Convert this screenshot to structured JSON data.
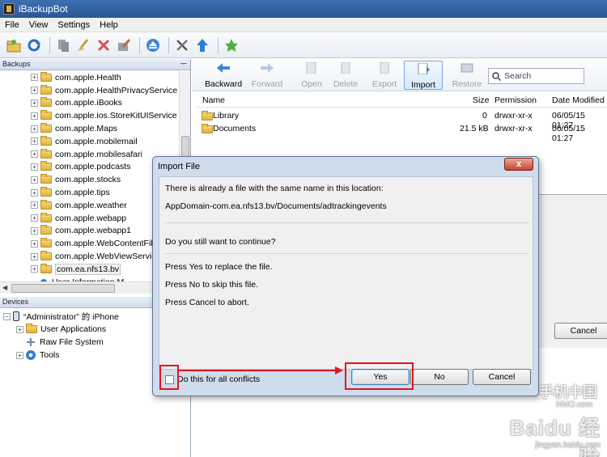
{
  "window": {
    "title": "iBackupBot"
  },
  "menu": [
    "File",
    "View",
    "Settings",
    "Help"
  ],
  "backups_panel": {
    "header": "Backups",
    "pin": "ᅮ",
    "items": [
      {
        "label": "com.apple.Health"
      },
      {
        "label": "com.apple.HealthPrivacyService"
      },
      {
        "label": "com.apple.iBooks"
      },
      {
        "label": "com.apple.ios.StoreKitUIService"
      },
      {
        "label": "com.apple.Maps"
      },
      {
        "label": "com.apple.mobilemail"
      },
      {
        "label": "com.apple.mobilesafari"
      },
      {
        "label": "com.apple.podcasts"
      },
      {
        "label": "com.apple.stocks"
      },
      {
        "label": "com.apple.tips"
      },
      {
        "label": "com.apple.weather"
      },
      {
        "label": "com.apple.webapp"
      },
      {
        "label": "com.apple.webapp1"
      },
      {
        "label": "com.apple.WebContentFilter"
      },
      {
        "label": "com.apple.WebViewService"
      },
      {
        "label": "com.ea.nfs13.bv",
        "selected": true
      },
      {
        "label": "User Information M"
      }
    ]
  },
  "devices_panel": {
    "header": "Devices",
    "device_name": "“Administrator” 的 iPhone",
    "items": [
      {
        "label": "User Applications"
      },
      {
        "label": "Raw File System"
      },
      {
        "label": "Tools"
      }
    ]
  },
  "right_toolbar": {
    "backward": "Backward",
    "forward": "Forward",
    "open": "Open",
    "delete": "Delete",
    "export": "Export",
    "import": "Import",
    "restore": "Restore",
    "search_placeholder": "Search"
  },
  "file_table": {
    "columns": [
      "Name",
      "Size",
      "Permission",
      "Date Modified"
    ],
    "rows": [
      {
        "name": "Library",
        "size": "0",
        "permission": "drwxr-xr-x",
        "date": "06/05/15 01:27"
      },
      {
        "name": "Documents",
        "size": "21.5 kB",
        "permission": "drwxr-xr-x",
        "date": "06/05/15 01:27"
      }
    ]
  },
  "background_dialog": {
    "cancel_label": "Cancel"
  },
  "dialog": {
    "title": "Import File",
    "close_label": "x",
    "line1": "There is already a file with the same name in this location:",
    "path": "AppDomain-com.ea.nfs13.bv/Documents/adtrackingevents",
    "question": "Do you still want to continue?",
    "hint_yes": "Press Yes to replace the file.",
    "hint_no": "Press No to skip this file.",
    "hint_cancel": "Press Cancel to abort.",
    "checkbox_label": "Do this for all conflicts",
    "checkbox_checked": false,
    "yes_label": "Yes",
    "no_label": "No",
    "cancel_label": "Cancel"
  },
  "watermark": {
    "line1": "手机中国",
    "line2": "NMO.com",
    "line3": "Baidu 经验",
    "line4": "jingyan.baidu.com"
  },
  "colors": {
    "annotation": "#e0161e",
    "titlebar": "#2a5796"
  }
}
